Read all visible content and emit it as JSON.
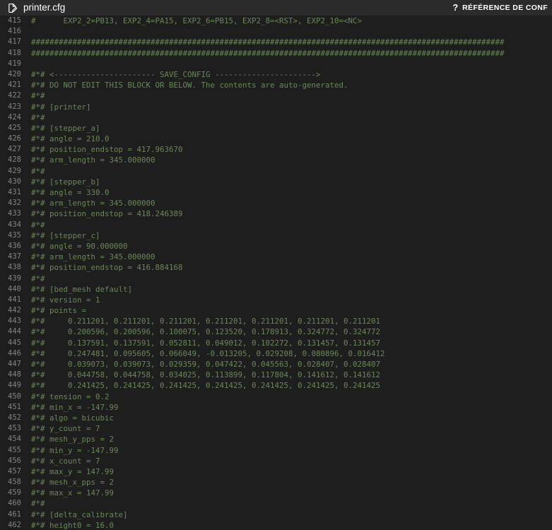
{
  "header": {
    "file_icon": "file-edit-icon",
    "title": "printer.cfg",
    "help_icon": "?",
    "reference_label": "RÉFÉRENCE DE CONF",
    "background_color": "#2b2b2b",
    "title_color": "#ffffff"
  },
  "editor": {
    "background_color": "#1e1e1e",
    "comment_color": "#6a8759",
    "lineno_color": "#838383",
    "first_line_number": 415,
    "lines": [
      {
        "n": 415,
        "text": "#      EXP2_2=PB13, EXP2_4=PA15, EXP2_6=PB15, EXP2_8=<RST>, EXP2_10=<NC>"
      },
      {
        "n": 416,
        "text": ""
      },
      {
        "n": 417,
        "text": "#######################################################################################################"
      },
      {
        "n": 418,
        "text": "#######################################################################################################"
      },
      {
        "n": 419,
        "text": ""
      },
      {
        "n": 420,
        "text": "#*# <---------------------- SAVE_CONFIG ---------------------->"
      },
      {
        "n": 421,
        "text": "#*# DO NOT EDIT THIS BLOCK OR BELOW. The contents are auto-generated."
      },
      {
        "n": 422,
        "text": "#*#"
      },
      {
        "n": 423,
        "text": "#*# [printer]"
      },
      {
        "n": 424,
        "text": "#*#"
      },
      {
        "n": 425,
        "text": "#*# [stepper_a]"
      },
      {
        "n": 426,
        "text": "#*# angle = 210.0"
      },
      {
        "n": 427,
        "text": "#*# position_endstop = 417.963670"
      },
      {
        "n": 428,
        "text": "#*# arm_length = 345.000000"
      },
      {
        "n": 429,
        "text": "#*#"
      },
      {
        "n": 430,
        "text": "#*# [stepper_b]"
      },
      {
        "n": 431,
        "text": "#*# angle = 330.0"
      },
      {
        "n": 432,
        "text": "#*# arm_length = 345.000000"
      },
      {
        "n": 433,
        "text": "#*# position_endstop = 418.246389"
      },
      {
        "n": 434,
        "text": "#*#"
      },
      {
        "n": 435,
        "text": "#*# [stepper_c]"
      },
      {
        "n": 436,
        "text": "#*# angle = 90.000000"
      },
      {
        "n": 437,
        "text": "#*# arm_length = 345.000000"
      },
      {
        "n": 438,
        "text": "#*# position_endstop = 416.884168"
      },
      {
        "n": 439,
        "text": "#*#"
      },
      {
        "n": 440,
        "text": "#*# [bed_mesh default]"
      },
      {
        "n": 441,
        "text": "#*# version = 1"
      },
      {
        "n": 442,
        "text": "#*# points ="
      },
      {
        "n": 443,
        "text": "#*#     0.211201, 0.211201, 0.211201, 0.211201, 0.211201, 0.211201, 0.211201"
      },
      {
        "n": 444,
        "text": "#*#     0.200596, 0.200596, 0.100075, 0.123520, 0.178913, 0.324772, 0.324772"
      },
      {
        "n": 445,
        "text": "#*#     0.137591, 0.137591, 0.052811, 0.049012, 0.102272, 0.131457, 0.131457"
      },
      {
        "n": 446,
        "text": "#*#     0.247481, 0.095605, 0.066049, -0.013205, 0.029208, 0.080896, 0.016412"
      },
      {
        "n": 447,
        "text": "#*#     0.039073, 0.039073, 0.029359, 0.047422, 0.045563, 0.028407, 0.028407"
      },
      {
        "n": 448,
        "text": "#*#     0.044758, 0.044758, 0.034025, 0.113899, 0.117804, 0.141612, 0.141612"
      },
      {
        "n": 449,
        "text": "#*#     0.241425, 0.241425, 0.241425, 0.241425, 0.241425, 0.241425, 0.241425"
      },
      {
        "n": 450,
        "text": "#*# tension = 0.2"
      },
      {
        "n": 451,
        "text": "#*# min_x = -147.99"
      },
      {
        "n": 452,
        "text": "#*# algo = bicubic"
      },
      {
        "n": 453,
        "text": "#*# y_count = 7"
      },
      {
        "n": 454,
        "text": "#*# mesh_y_pps = 2"
      },
      {
        "n": 455,
        "text": "#*# min_y = -147.99"
      },
      {
        "n": 456,
        "text": "#*# x_count = 7"
      },
      {
        "n": 457,
        "text": "#*# max_y = 147.99"
      },
      {
        "n": 458,
        "text": "#*# mesh_x_pps = 2"
      },
      {
        "n": 459,
        "text": "#*# max_x = 147.99"
      },
      {
        "n": 460,
        "text": "#*#"
      },
      {
        "n": 461,
        "text": "#*# [delta_calibrate]"
      },
      {
        "n": 462,
        "text": "#*# height0 = 16.0"
      }
    ]
  }
}
